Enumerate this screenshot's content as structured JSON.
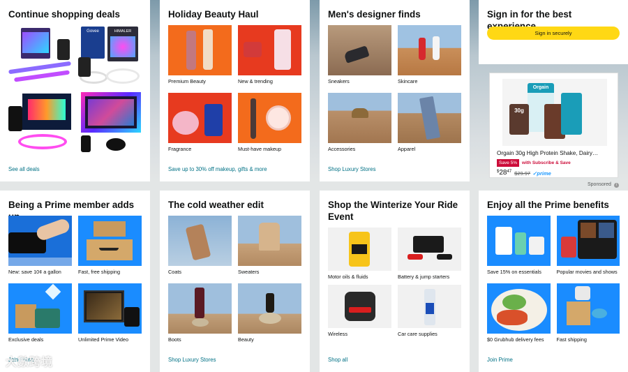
{
  "cards": {
    "deals": {
      "title": "Continue shopping deals",
      "link": "See all deals",
      "tile_labels": [
        "Govee",
        "HIMALER"
      ]
    },
    "beauty": {
      "title": "Holiday Beauty Haul",
      "tiles": [
        "Premium Beauty",
        "New & trending",
        "Fragrance",
        "Must-have makeup"
      ],
      "link": "Save up to 30% off makeup, gifts & more"
    },
    "mens": {
      "title": "Men's designer finds",
      "tiles": [
        "Sneakers",
        "Skincare",
        "Accessories",
        "Apparel"
      ],
      "link": "Shop Luxury Stores"
    },
    "signin": {
      "title": "Sign in for the best experience",
      "button": "Sign in securely"
    },
    "ad": {
      "product": "Orgain 30g High Protein Shake, Dairy…",
      "badge": "Save 5%",
      "subscribe": "with Subscribe & Save",
      "price_symbol": "$",
      "price_whole": "28",
      "price_fraction": "47",
      "list_price": "$29.97",
      "prime": "✓prime",
      "sponsored": "Sponsored",
      "package_text": "30g",
      "brand": "Orgain"
    },
    "prime_member": {
      "title": "Being a Prime member adds up",
      "tiles": [
        "New: save 10¢ a gallon",
        "Fast, free shipping",
        "Exclusive deals",
        "Unlimited Prime Video"
      ],
      "link": "Join Prime"
    },
    "cold": {
      "title": "The cold weather edit",
      "tiles": [
        "Coats",
        "Sweaters",
        "Boots",
        "Beauty"
      ],
      "link": "Shop Luxury Stores"
    },
    "winterize": {
      "title": "Shop the Winterize Your Ride Event",
      "tiles": [
        "Motor oils & fluids",
        "Battery & jump starters",
        "Wireless",
        "Car care supplies"
      ],
      "link": "Shop all"
    },
    "prime_benefits": {
      "title": "Enjoy all the Prime benefits",
      "tiles": [
        "Save 15% on essentials",
        "Popular movies and shows",
        "$0 Grubhub delivery fees",
        "Fast shipping"
      ],
      "link": "Join Prime"
    }
  },
  "watermark": "大數跨境",
  "colors": {
    "link": "#007185",
    "signin_button": "#ffd814",
    "prime_blue": "#1a98ff",
    "beauty_orange": "#f36b1c",
    "save_badge": "#cc0c39"
  }
}
